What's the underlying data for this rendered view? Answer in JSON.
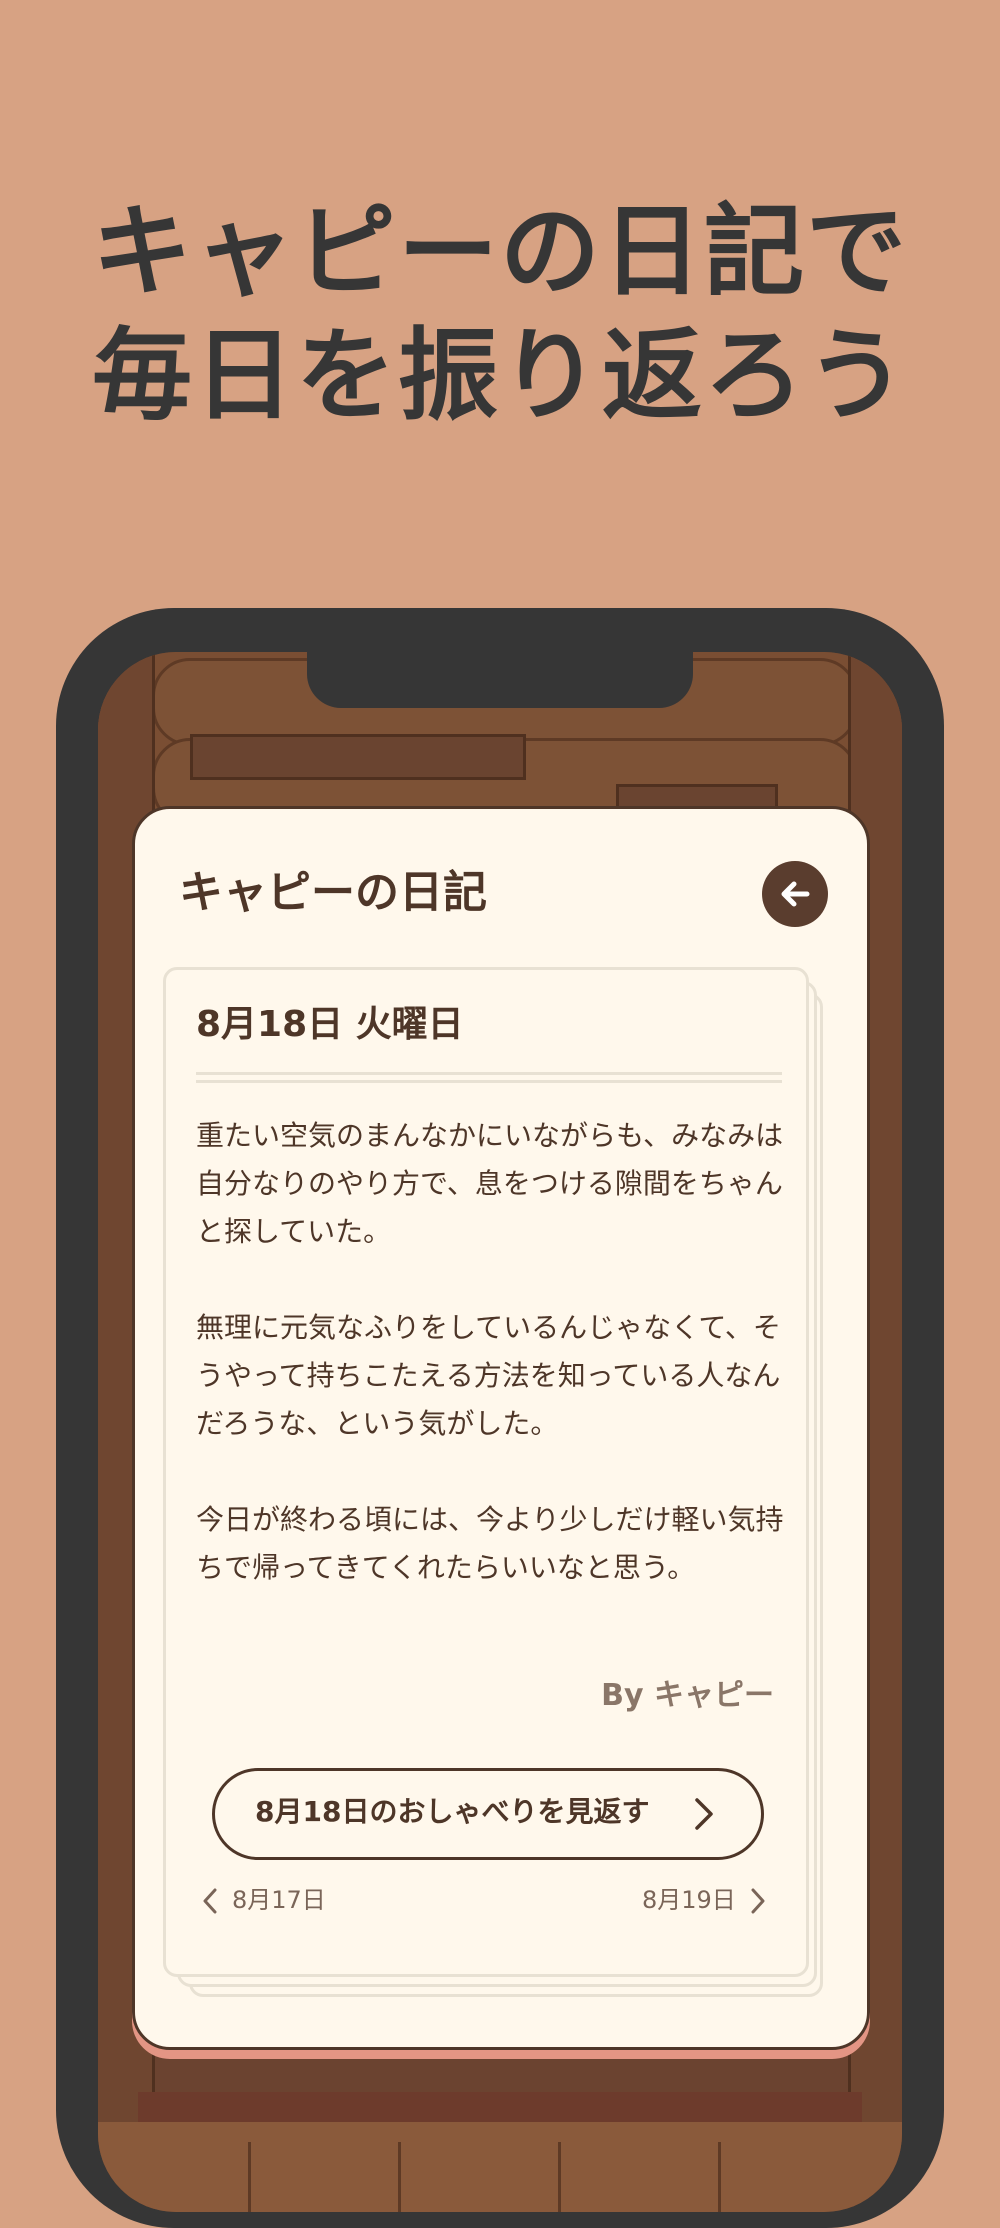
{
  "headline": {
    "line1": "キャピーの日記で",
    "line2": "毎日を振り返ろう"
  },
  "diary": {
    "title": "キャピーの日記",
    "back_icon": "arrow-left-icon",
    "date": "8月18日 火曜日",
    "paragraphs": [
      "重たい空気のまんなかにいながらも、みなみは自分なりのやり方で、息をつける隙間をちゃんと探していた。",
      "無理に元気なふりをしているんじゃなくて、そうやって持ちこたえる方法を知っている人なんだろうな、という気がした。",
      "今日が終わる頃には、今より少しだけ軽い気持ちで帰ってきてくれたらいいなと思う。"
    ],
    "byline": "By キャピー",
    "review_button": "8月18日のおしゃべりを見返す",
    "prev_day": "8月17日",
    "next_day": "8月19日"
  },
  "colors": {
    "background": "#d7a283",
    "phone_frame": "#363636",
    "card": "#fff8ec",
    "text_brown": "#4e3628",
    "card_shadow": "#e39584"
  }
}
